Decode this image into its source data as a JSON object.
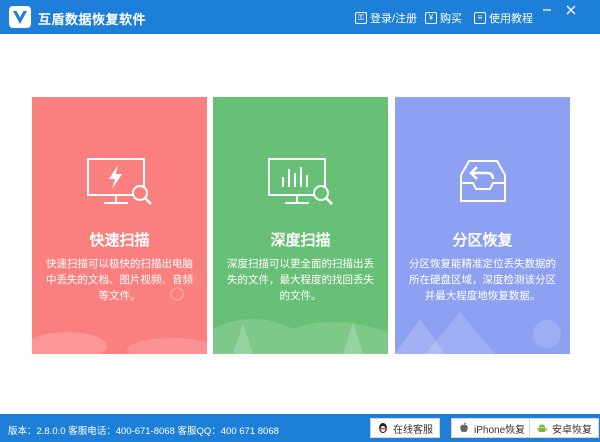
{
  "app": {
    "title": "互盾数据恢复软件"
  },
  "header": {
    "login_label": "登录/注册",
    "buy_label": "购买",
    "tutorial_label": "使用教程"
  },
  "cards": [
    {
      "title": "快速扫描",
      "description": "快速扫描可以极快的扫描出电脑中丢失的文档、图片视频、音频等文件。",
      "color": "#fa8080"
    },
    {
      "title": "深度扫描",
      "description": "深度扫描可以更全面的扫描出丢失的文件，最大程度的找回丢失的文件。",
      "color": "#68c076"
    },
    {
      "title": "分区恢复",
      "description": "分区恢复能精准定位丢失数据的所在硬盘区域，深度检测该分区并最大程度地恢复数据。",
      "color": "#8ea0f2"
    }
  ],
  "footer": {
    "status_text": "版本：2.8.0.0  客服电话：400-671-8068     客服QQ：400 671 8068",
    "online_service_label": "在线客服",
    "iphone_label": "iPhone恢复",
    "android_label": "安卓恢复"
  },
  "colors": {
    "titlebar": "#1e7fd8",
    "accent": "#1e7fd8"
  }
}
